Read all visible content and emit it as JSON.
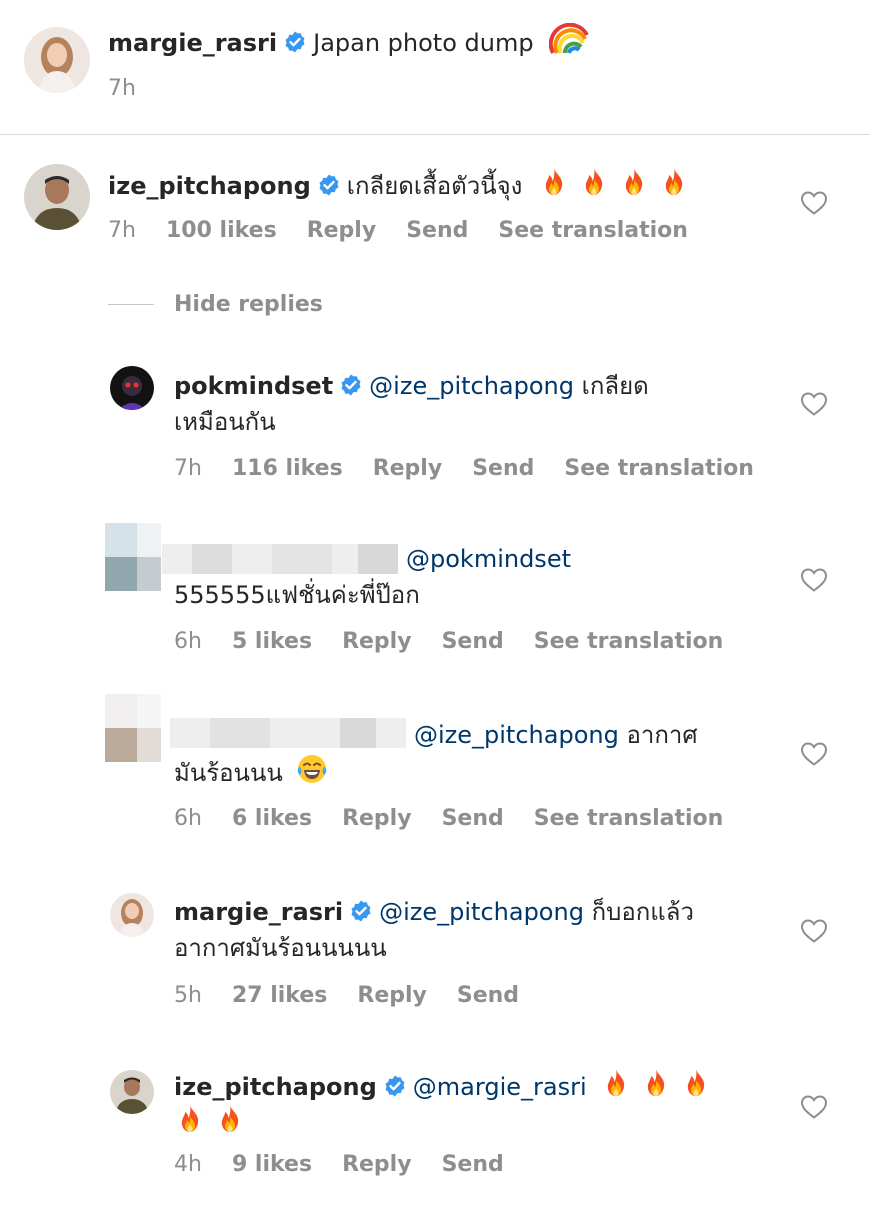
{
  "post": {
    "username": "margie_rasri",
    "caption": "Japan photo dump",
    "caption_emoji": "rainbow",
    "time": "7h"
  },
  "comments": [
    {
      "username": "ize_pitchapong",
      "text": "เกลียดเสื้อตัวนี้จุง",
      "emoji": "fire x4",
      "time": "7h",
      "likes": "100 likes",
      "reply": "Reply",
      "send": "Send",
      "translate": "See translation",
      "hide_replies": "Hide replies",
      "replies": [
        {
          "username": "pokmindset",
          "mention": "@ize_pitchapong",
          "text_line1": "เกลียด",
          "text_line2": "เหมือนกัน",
          "time": "7h",
          "likes": "116 likes",
          "reply": "Reply",
          "send": "Send",
          "translate": "See translation"
        },
        {
          "username": "",
          "mention": "@pokmindset",
          "text_line2": "555555แฟชั่นค่ะพี่ป๊อก",
          "time": "6h",
          "likes": "5 likes",
          "reply": "Reply",
          "send": "Send",
          "translate": "See translation"
        },
        {
          "username": "",
          "mention": "@ize_pitchapong",
          "text_line1": "อากาศ",
          "text_line2": "มันร้อนนน",
          "emoji": "joy",
          "time": "6h",
          "likes": "6 likes",
          "reply": "Reply",
          "send": "Send",
          "translate": "See translation"
        },
        {
          "username": "margie_rasri",
          "mention": "@ize_pitchapong",
          "text_line1": "ก็บอกแล้ว",
          "text_line2": "อากาศมันร้อนนนนน",
          "time": "5h",
          "likes": "27 likes",
          "reply": "Reply",
          "send": "Send"
        },
        {
          "username": "ize_pitchapong",
          "mention": "@margie_rasri",
          "emoji": "fire x5",
          "time": "4h",
          "likes": "9 likes",
          "reply": "Reply",
          "send": "Send"
        }
      ]
    }
  ],
  "icons": {
    "verified": "verified-badge-icon",
    "heart": "heart-outline-icon"
  },
  "colors": {
    "text": "#262626",
    "secondary": "#8e8e8e",
    "mention": "#00376b",
    "verified": "#3897f0"
  }
}
